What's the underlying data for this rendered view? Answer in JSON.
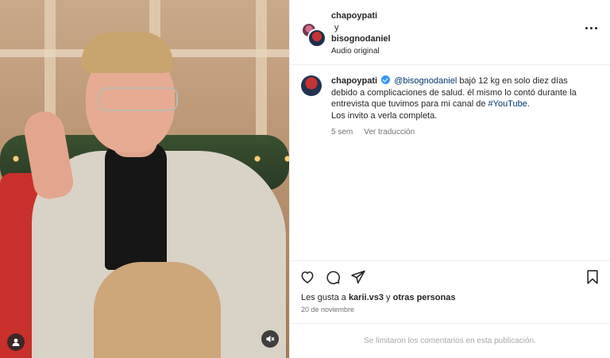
{
  "header": {
    "author1": "chapoypati",
    "conjunction": "y",
    "author2": "bisognodaniel",
    "audio": "Audio original"
  },
  "caption": {
    "username": "chapoypati",
    "mention": "@bisognodaniel",
    "text_part1": " bajó 12 kg en solo diez días debido a complicaciones de salud. él mismo lo contó durante la entrevista que tuvimos para mi canal de ",
    "hashtag": "#YouTube",
    "text_part2": ".",
    "line2": "Los invito a verla completa.",
    "time": "5 sem",
    "translate": "Ver traducción"
  },
  "actions": {
    "like_icon": "heart-icon",
    "comment_icon": "comment-icon",
    "share_icon": "share-icon",
    "save_icon": "bookmark-icon"
  },
  "likes": {
    "prefix": "Les gusta a ",
    "user": "karii.vs3",
    "middle": " y ",
    "others": "otras personas"
  },
  "date": "20 de noviembre",
  "comments_notice": "Se limitaron los comentarios en esta publicación.",
  "colors": {
    "verified": "#3897f0",
    "link": "#00376b",
    "muted": "#737373"
  }
}
